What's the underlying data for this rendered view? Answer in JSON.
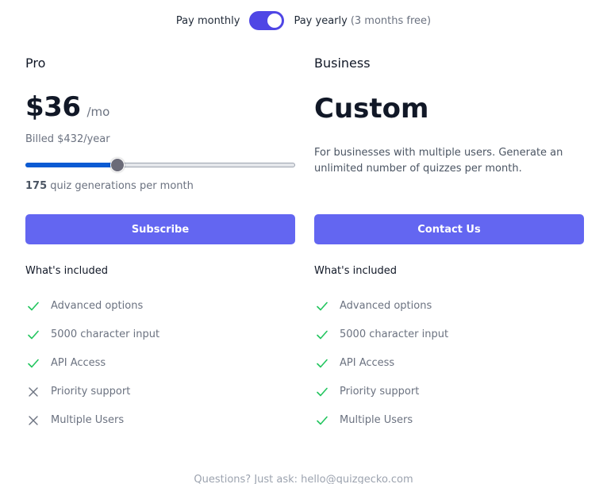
{
  "billing_toggle": {
    "monthly_label": "Pay monthly",
    "yearly_label": "Pay yearly",
    "yearly_note": "(3 months free)",
    "selected": "yearly",
    "accent_color": "#4f46e5"
  },
  "plans": [
    {
      "name": "Pro",
      "price": "$36",
      "period": "/mo",
      "billed": "Billed $432/year",
      "slider": {
        "fraction": 0.34,
        "count": "175",
        "count_suffix": "quiz generations per month"
      },
      "cta_label": "Subscribe",
      "included_title": "What's included",
      "features": [
        {
          "label": "Advanced options",
          "included": true,
          "icon": "check-icon"
        },
        {
          "label": "5000 character input",
          "included": true,
          "icon": "check-icon"
        },
        {
          "label": "API Access",
          "included": true,
          "icon": "check-icon"
        },
        {
          "label": "Priority support",
          "included": false,
          "icon": "x-icon"
        },
        {
          "label": "Multiple Users",
          "included": false,
          "icon": "x-icon"
        }
      ]
    },
    {
      "name": "Business",
      "price": "Custom",
      "description": "For businesses with multiple users. Generate an unlimited number of quizzes per month.",
      "cta_label": "Contact Us",
      "included_title": "What's included",
      "features": [
        {
          "label": "Advanced options",
          "included": true,
          "icon": "check-icon"
        },
        {
          "label": "5000 character input",
          "included": true,
          "icon": "check-icon"
        },
        {
          "label": "API Access",
          "included": true,
          "icon": "check-icon"
        },
        {
          "label": "Priority support",
          "included": true,
          "icon": "check-icon"
        },
        {
          "label": "Multiple Users",
          "included": true,
          "icon": "check-icon"
        }
      ]
    }
  ],
  "colors": {
    "button": "#6366f1",
    "check": "#22c55e",
    "cross": "#6b7280",
    "slider_fill": "#0b5bd3"
  },
  "footer": {
    "text": "Questions? Just ask: hello@quizgecko.com"
  }
}
